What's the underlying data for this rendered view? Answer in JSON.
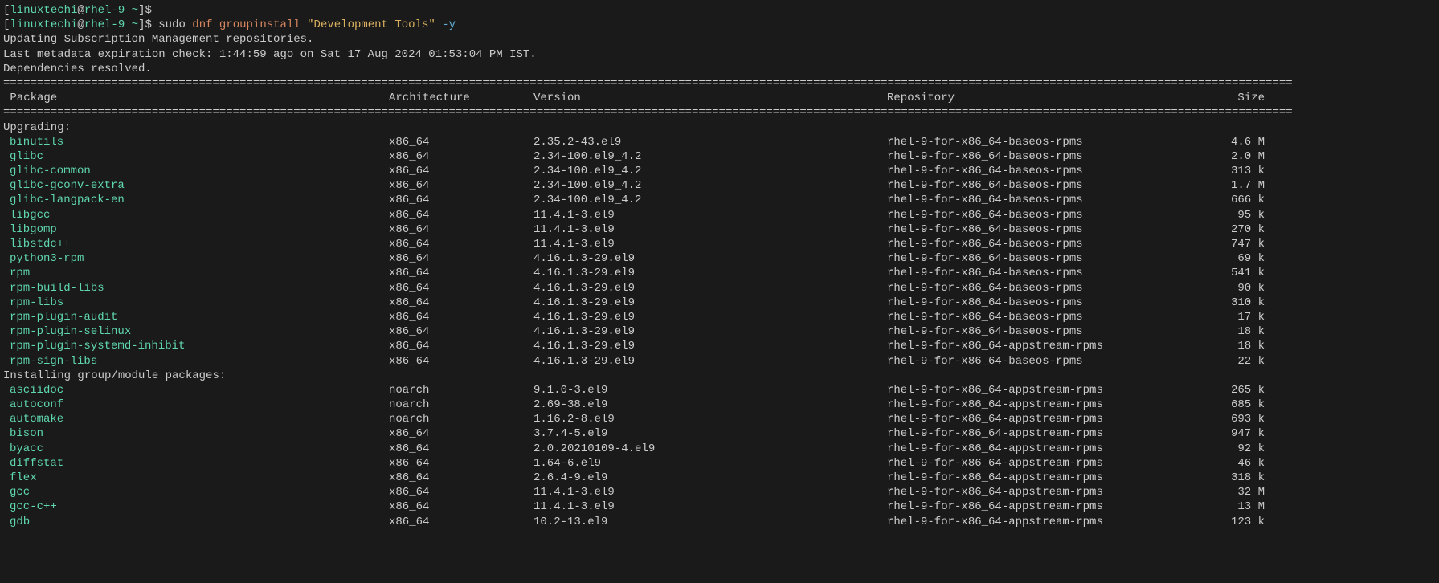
{
  "prompt1": {
    "user": "linuxtechi",
    "host": "rhel-9",
    "path": "~",
    "symbol": "$"
  },
  "prompt2": {
    "user": "linuxtechi",
    "host": "rhel-9",
    "path": "~",
    "symbol": "$",
    "cmd_sudo": "sudo",
    "cmd_dnf": "dnf",
    "cmd_action": "groupinstall",
    "cmd_arg": "\"Development Tools\"",
    "cmd_flag": "-y"
  },
  "status": {
    "line1": "Updating Subscription Management repositories.",
    "line2": "Last metadata expiration check: 1:44:59 ago on Sat 17 Aug 2024 01:53:04 PM IST.",
    "line3": "Dependencies resolved."
  },
  "divider": "===============================================================================================================================================================================================",
  "headers": {
    "package": " Package",
    "arch": "Architecture",
    "version": "Version",
    "repo": "Repository",
    "size": "Size"
  },
  "sections": {
    "upgrading": "Upgrading:",
    "installing": "Installing group/module packages:"
  },
  "upgrading_packages": [
    {
      "name": "binutils",
      "arch": "x86_64",
      "version": "2.35.2-43.el9",
      "repo": "rhel-9-for-x86_64-baseos-rpms",
      "size": "4.6 M"
    },
    {
      "name": "glibc",
      "arch": "x86_64",
      "version": "2.34-100.el9_4.2",
      "repo": "rhel-9-for-x86_64-baseos-rpms",
      "size": "2.0 M"
    },
    {
      "name": "glibc-common",
      "arch": "x86_64",
      "version": "2.34-100.el9_4.2",
      "repo": "rhel-9-for-x86_64-baseos-rpms",
      "size": "313 k"
    },
    {
      "name": "glibc-gconv-extra",
      "arch": "x86_64",
      "version": "2.34-100.el9_4.2",
      "repo": "rhel-9-for-x86_64-baseos-rpms",
      "size": "1.7 M"
    },
    {
      "name": "glibc-langpack-en",
      "arch": "x86_64",
      "version": "2.34-100.el9_4.2",
      "repo": "rhel-9-for-x86_64-baseos-rpms",
      "size": "666 k"
    },
    {
      "name": "libgcc",
      "arch": "x86_64",
      "version": "11.4.1-3.el9",
      "repo": "rhel-9-for-x86_64-baseos-rpms",
      "size": "95 k"
    },
    {
      "name": "libgomp",
      "arch": "x86_64",
      "version": "11.4.1-3.el9",
      "repo": "rhel-9-for-x86_64-baseos-rpms",
      "size": "270 k"
    },
    {
      "name": "libstdc++",
      "arch": "x86_64",
      "version": "11.4.1-3.el9",
      "repo": "rhel-9-for-x86_64-baseos-rpms",
      "size": "747 k"
    },
    {
      "name": "python3-rpm",
      "arch": "x86_64",
      "version": "4.16.1.3-29.el9",
      "repo": "rhel-9-for-x86_64-baseos-rpms",
      "size": "69 k"
    },
    {
      "name": "rpm",
      "arch": "x86_64",
      "version": "4.16.1.3-29.el9",
      "repo": "rhel-9-for-x86_64-baseos-rpms",
      "size": "541 k"
    },
    {
      "name": "rpm-build-libs",
      "arch": "x86_64",
      "version": "4.16.1.3-29.el9",
      "repo": "rhel-9-for-x86_64-baseos-rpms",
      "size": "90 k"
    },
    {
      "name": "rpm-libs",
      "arch": "x86_64",
      "version": "4.16.1.3-29.el9",
      "repo": "rhel-9-for-x86_64-baseos-rpms",
      "size": "310 k"
    },
    {
      "name": "rpm-plugin-audit",
      "arch": "x86_64",
      "version": "4.16.1.3-29.el9",
      "repo": "rhel-9-for-x86_64-baseos-rpms",
      "size": "17 k"
    },
    {
      "name": "rpm-plugin-selinux",
      "arch": "x86_64",
      "version": "4.16.1.3-29.el9",
      "repo": "rhel-9-for-x86_64-baseos-rpms",
      "size": "18 k"
    },
    {
      "name": "rpm-plugin-systemd-inhibit",
      "arch": "x86_64",
      "version": "4.16.1.3-29.el9",
      "repo": "rhel-9-for-x86_64-appstream-rpms",
      "size": "18 k"
    },
    {
      "name": "rpm-sign-libs",
      "arch": "x86_64",
      "version": "4.16.1.3-29.el9",
      "repo": "rhel-9-for-x86_64-baseos-rpms",
      "size": "22 k"
    }
  ],
  "installing_packages": [
    {
      "name": "asciidoc",
      "arch": "noarch",
      "version": "9.1.0-3.el9",
      "repo": "rhel-9-for-x86_64-appstream-rpms",
      "size": "265 k"
    },
    {
      "name": "autoconf",
      "arch": "noarch",
      "version": "2.69-38.el9",
      "repo": "rhel-9-for-x86_64-appstream-rpms",
      "size": "685 k"
    },
    {
      "name": "automake",
      "arch": "noarch",
      "version": "1.16.2-8.el9",
      "repo": "rhel-9-for-x86_64-appstream-rpms",
      "size": "693 k"
    },
    {
      "name": "bison",
      "arch": "x86_64",
      "version": "3.7.4-5.el9",
      "repo": "rhel-9-for-x86_64-appstream-rpms",
      "size": "947 k"
    },
    {
      "name": "byacc",
      "arch": "x86_64",
      "version": "2.0.20210109-4.el9",
      "repo": "rhel-9-for-x86_64-appstream-rpms",
      "size": "92 k"
    },
    {
      "name": "diffstat",
      "arch": "x86_64",
      "version": "1.64-6.el9",
      "repo": "rhel-9-for-x86_64-appstream-rpms",
      "size": "46 k"
    },
    {
      "name": "flex",
      "arch": "x86_64",
      "version": "2.6.4-9.el9",
      "repo": "rhel-9-for-x86_64-appstream-rpms",
      "size": "318 k"
    },
    {
      "name": "gcc",
      "arch": "x86_64",
      "version": "11.4.1-3.el9",
      "repo": "rhel-9-for-x86_64-appstream-rpms",
      "size": "32 M"
    },
    {
      "name": "gcc-c++",
      "arch": "x86_64",
      "version": "11.4.1-3.el9",
      "repo": "rhel-9-for-x86_64-appstream-rpms",
      "size": "13 M"
    },
    {
      "name": "gdb",
      "arch": "x86_64",
      "version": "10.2-13.el9",
      "repo": "rhel-9-for-x86_64-appstream-rpms",
      "size": "123 k"
    }
  ]
}
